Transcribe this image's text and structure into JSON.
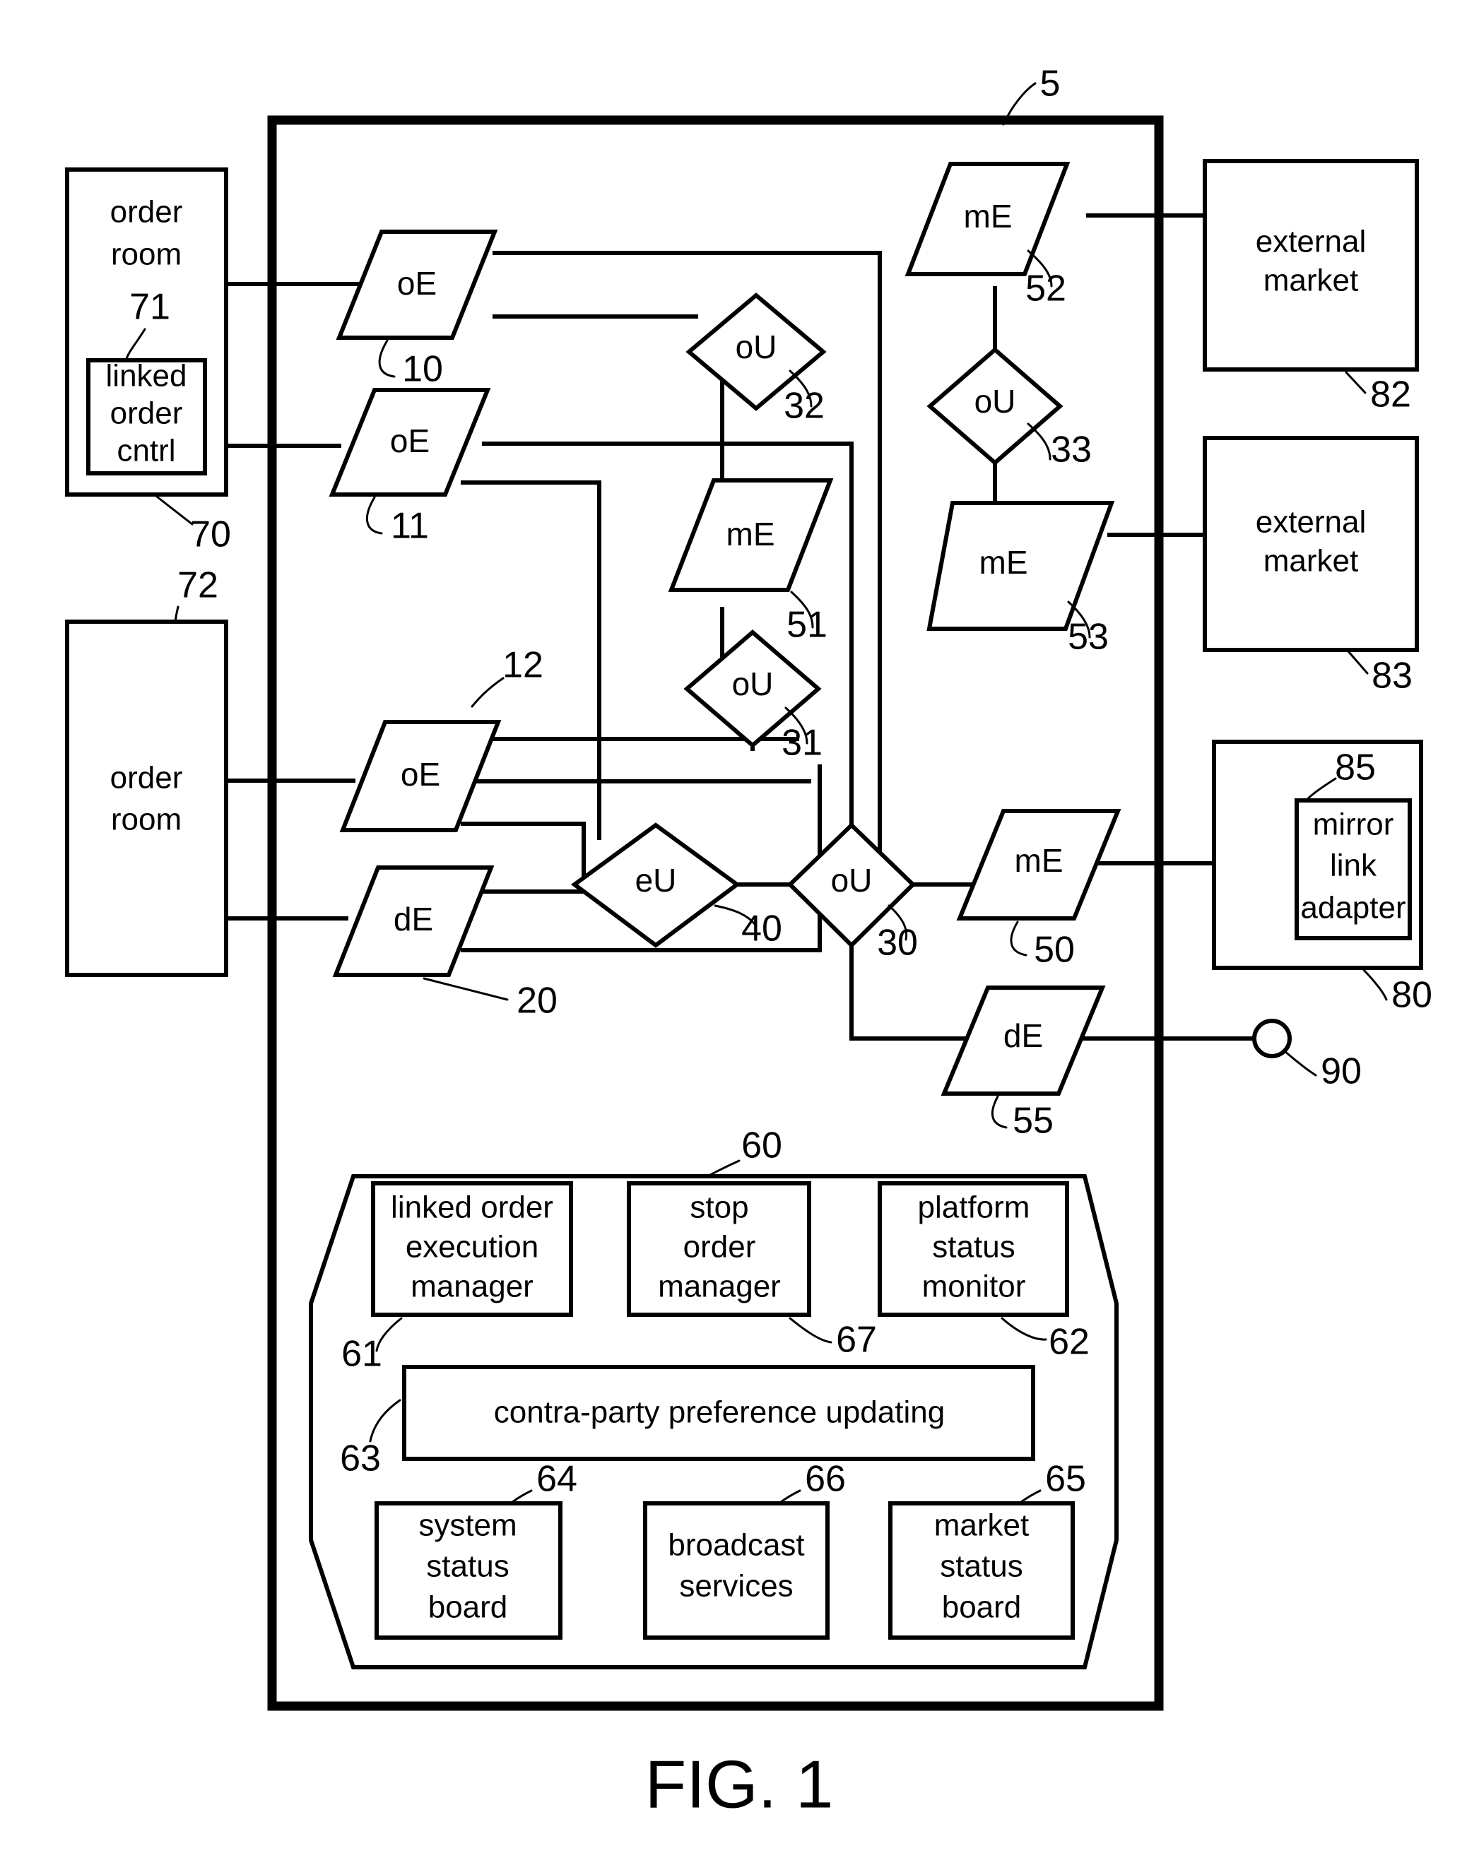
{
  "figure": {
    "caption": "FIG. 1",
    "system_ref": "5"
  },
  "left_blocks": [
    {
      "id": "order-room-70",
      "lines": [
        "order",
        "room"
      ],
      "ref": "70",
      "inner": {
        "lines": [
          "linked",
          "order",
          "cntrl"
        ],
        "ref": "71"
      }
    },
    {
      "id": "order-room-72",
      "lines": [
        "order",
        "room"
      ],
      "ref": "72"
    }
  ],
  "right_blocks": [
    {
      "id": "external-market-82",
      "lines": [
        "external",
        "market"
      ],
      "ref": "82"
    },
    {
      "id": "external-market-83",
      "lines": [
        "external",
        "market"
      ],
      "ref": "83"
    },
    {
      "id": "mirror-link-host-80",
      "lines": [],
      "ref": "80",
      "inner": {
        "lines": [
          "mirror",
          "link",
          "adapter"
        ],
        "ref": "85"
      }
    }
  ],
  "engines": [
    {
      "id": "oE-10",
      "label": "oE",
      "ref": "10",
      "shape": "parallelogram"
    },
    {
      "id": "oE-11",
      "label": "oE",
      "ref": "11",
      "shape": "parallelogram"
    },
    {
      "id": "oE-12",
      "label": "oE",
      "ref": "12",
      "shape": "parallelogram"
    },
    {
      "id": "dE-20",
      "label": "dE",
      "ref": "20",
      "shape": "parallelogram"
    },
    {
      "id": "mE-50",
      "label": "mE",
      "ref": "50",
      "shape": "parallelogram"
    },
    {
      "id": "mE-51",
      "label": "mE",
      "ref": "51",
      "shape": "parallelogram"
    },
    {
      "id": "mE-52",
      "label": "mE",
      "ref": "52",
      "shape": "parallelogram"
    },
    {
      "id": "mE-53",
      "label": "mE",
      "ref": "53",
      "shape": "parallelogram"
    },
    {
      "id": "dE-55",
      "label": "dE",
      "ref": "55",
      "shape": "parallelogram"
    }
  ],
  "updaters": [
    {
      "id": "oU-30",
      "label": "oU",
      "ref": "30",
      "shape": "diamond"
    },
    {
      "id": "oU-31",
      "label": "oU",
      "ref": "31",
      "shape": "diamond"
    },
    {
      "id": "oU-32",
      "label": "oU",
      "ref": "32",
      "shape": "diamond"
    },
    {
      "id": "oU-33",
      "label": "oU",
      "ref": "33",
      "shape": "diamond"
    },
    {
      "id": "eU-40",
      "label": "eU",
      "ref": "40",
      "shape": "diamond"
    }
  ],
  "terminal": {
    "id": "terminal-90",
    "ref": "90",
    "shape": "circle"
  },
  "services_panel": {
    "ref": "60",
    "items": [
      {
        "id": "linked-order-execution-manager",
        "lines": [
          "linked order",
          "execution",
          "manager"
        ],
        "ref": "61"
      },
      {
        "id": "stop-order-manager",
        "lines": [
          "stop",
          "order",
          "manager"
        ],
        "ref": "67"
      },
      {
        "id": "platform-status-monitor",
        "lines": [
          "platform",
          "status",
          "monitor"
        ],
        "ref": "62"
      },
      {
        "id": "contra-party-preference-updating",
        "lines": [
          "contra-party preference updating"
        ],
        "ref": "63"
      },
      {
        "id": "system-status-board",
        "lines": [
          "system",
          "status",
          "board"
        ],
        "ref": "64"
      },
      {
        "id": "broadcast-services",
        "lines": [
          "broadcast",
          "services"
        ],
        "ref": "66"
      },
      {
        "id": "market-status-board",
        "lines": [
          "market",
          "status",
          "board"
        ],
        "ref": "65"
      }
    ]
  },
  "colors": {
    "stroke": "#000000",
    "background": "#ffffff"
  }
}
